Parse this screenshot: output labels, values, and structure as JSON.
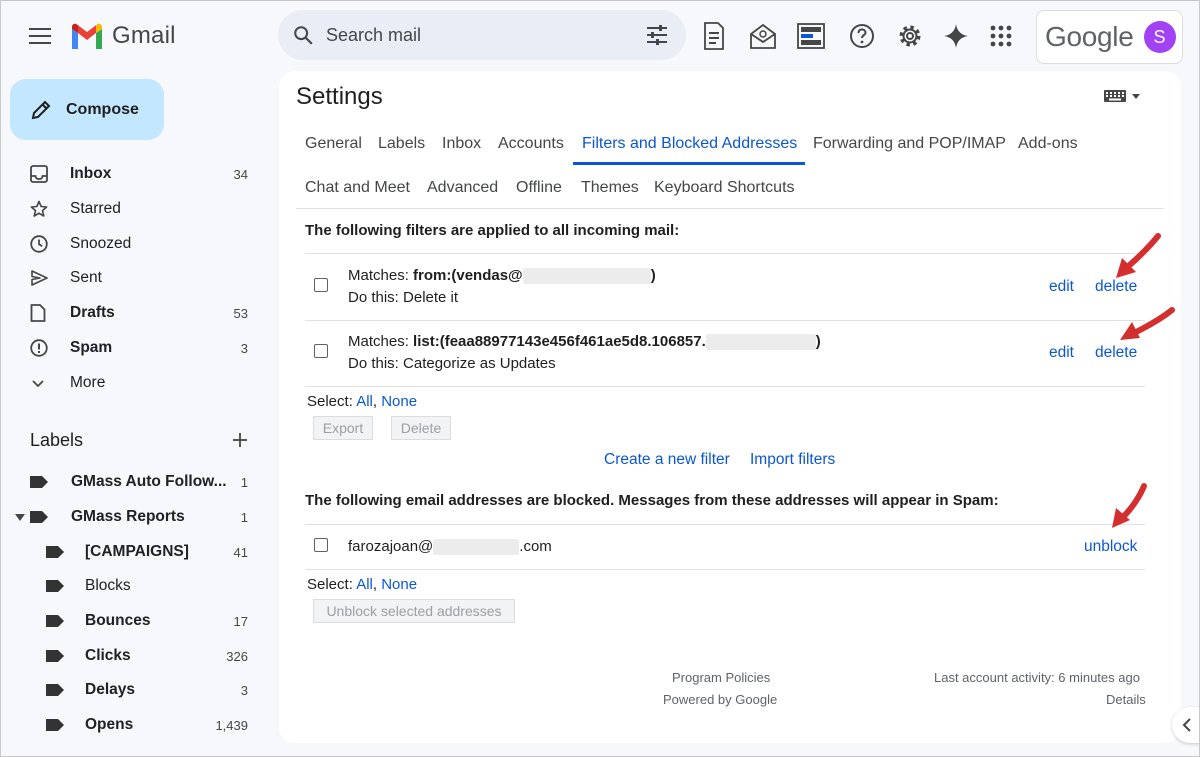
{
  "header": {
    "app_name": "Gmail",
    "search_placeholder": "Search mail",
    "account_brand": "Google",
    "avatar_initial": "S",
    "icons": [
      "main-menu-icon",
      "search-icon",
      "search-options-icon",
      "doc-icon",
      "mail-open-icon",
      "layout-icon",
      "help-icon",
      "settings-icon",
      "gemini-icon",
      "apps-icon"
    ]
  },
  "sidebar": {
    "compose_label": "Compose",
    "nav": [
      {
        "label": "Inbox",
        "count": "34",
        "bold": true,
        "icon": "inbox-icon"
      },
      {
        "label": "Starred",
        "count": "",
        "bold": false,
        "icon": "star-icon"
      },
      {
        "label": "Snoozed",
        "count": "",
        "bold": false,
        "icon": "clock-icon"
      },
      {
        "label": "Sent",
        "count": "",
        "bold": false,
        "icon": "send-icon"
      },
      {
        "label": "Drafts",
        "count": "53",
        "bold": true,
        "icon": "draft-icon"
      },
      {
        "label": "Spam",
        "count": "3",
        "bold": true,
        "icon": "spam-icon"
      },
      {
        "label": "More",
        "count": "",
        "bold": false,
        "icon": "chevron-down-icon"
      }
    ],
    "labels_heading": "Labels",
    "labels": [
      {
        "label": "GMass Auto Follow...",
        "count": "1"
      },
      {
        "label": "GMass Reports",
        "count": "1"
      },
      {
        "label": "[CAMPAIGNS]",
        "count": "41"
      },
      {
        "label": "Blocks",
        "count": ""
      },
      {
        "label": "Bounces",
        "count": "17"
      },
      {
        "label": "Clicks",
        "count": "326"
      },
      {
        "label": "Delays",
        "count": "3"
      },
      {
        "label": "Opens",
        "count": "1,439"
      }
    ]
  },
  "settings": {
    "title": "Settings",
    "tabs_row1": [
      "General",
      "Labels",
      "Inbox",
      "Accounts",
      "Filters and Blocked Addresses",
      "Forwarding and POP/IMAP",
      "Add-ons"
    ],
    "tabs_row2": [
      "Chat and Meet",
      "Advanced",
      "Offline",
      "Themes",
      "Keyboard Shortcuts"
    ],
    "active_tab": "Filters and Blocked Addresses",
    "filters_heading": "The following filters are applied to all incoming mail:",
    "filters": [
      {
        "matches_label": "Matches: ",
        "matches_value": "from:(vendas@",
        "matches_end": ")",
        "action": "Do this: Delete it",
        "edit": "edit",
        "delete": "delete"
      },
      {
        "matches_label": "Matches: ",
        "matches_value": "list:(feaa88977143e456f461ae5d8.106857.",
        "matches_end": ")",
        "action": "Do this: Categorize as Updates",
        "edit": "edit",
        "delete": "delete"
      }
    ],
    "select_label": "Select: ",
    "select_all": "All",
    "select_none": "None",
    "export_button": "Export",
    "delete_button": "Delete",
    "create_filter_link": "Create a new filter",
    "import_filters_link": "Import filters",
    "blocked_heading": "The following email addresses are blocked. Messages from these addresses will appear in Spam:",
    "blocked": [
      {
        "address_start": "farozajoan@",
        "address_end": ".com",
        "unblock": "unblock"
      }
    ],
    "unblock_selected_button": "Unblock selected addresses"
  },
  "footer": {
    "program_policies": "Program Policies",
    "powered_by": "Powered by Google",
    "last_activity": "Last account activity: 6 minutes ago",
    "details": "Details"
  },
  "colors": {
    "accent": "#0b57d0",
    "compose_bg": "#c2e7ff",
    "annotation_arrow": "#d32f2f",
    "avatar": "#a142f4"
  }
}
